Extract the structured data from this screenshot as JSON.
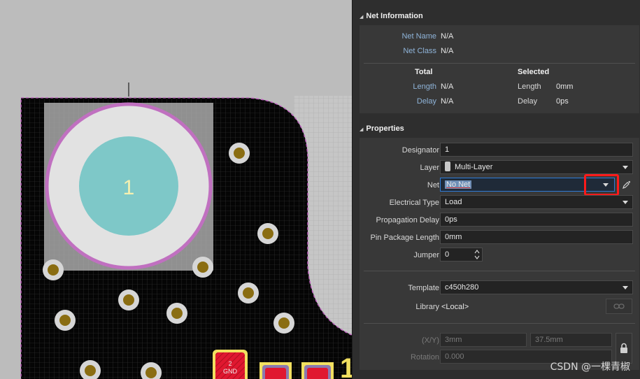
{
  "pcb": {
    "pad_designator": "1",
    "pad2_line1": "2",
    "pad2_line2": "GND",
    "edge_label": "1"
  },
  "net_info": {
    "title": "Net Information",
    "net_name_label": "Net Name",
    "net_name_value": "N/A",
    "net_class_label": "Net Class",
    "net_class_value": "N/A",
    "total_header": "Total",
    "selected_header": "Selected",
    "total_length_label": "Length",
    "total_length_value": "N/A",
    "total_delay_label": "Delay",
    "total_delay_value": "N/A",
    "sel_length_label": "Length",
    "sel_length_value": "0mm",
    "sel_delay_label": "Delay",
    "sel_delay_value": "0ps"
  },
  "properties": {
    "title": "Properties",
    "designator_label": "Designator",
    "designator_value": "1",
    "layer_label": "Layer",
    "layer_value": "Multi-Layer",
    "net_label": "Net",
    "net_value": "No Net",
    "electrical_type_label": "Electrical Type",
    "electrical_type_value": "Load",
    "propagation_delay_label": "Propagation Delay",
    "propagation_delay_value": "0ps",
    "pin_package_length_label": "Pin Package Length",
    "pin_package_length_value": "0mm",
    "jumper_label": "Jumper",
    "jumper_value": "0",
    "template_label": "Template",
    "template_value": "c450h280",
    "library_label": "Library",
    "library_value": "<Local>",
    "xy_label": "(X/Y)",
    "x_value": "3mm",
    "y_value": "37.5mm",
    "rotation_label": "Rotation",
    "rotation_value": "0.000"
  },
  "icons": {
    "section_toggle": "triangle-icon",
    "net_picker": "eyedropper-icon",
    "library_link": "link-icon",
    "lock": "lock-icon"
  },
  "colors": {
    "highlight_red": "#ff1a1a",
    "pad_teal": "#7ec8c8",
    "board_outline": "#c060c0",
    "label_blue": "#8fb4d9"
  },
  "watermark": "CSDN @一棵青椒"
}
